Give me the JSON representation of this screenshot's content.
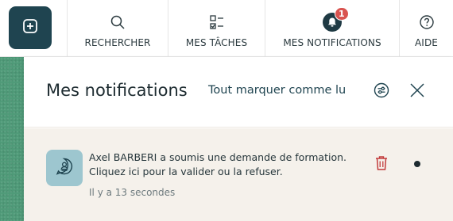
{
  "nav": {
    "search_label": "RECHERCHER",
    "tasks_label": "MES TÂCHES",
    "notifications_label": "MES NOTIFICATIONS",
    "notifications_badge": "1",
    "help_label": "AIDE"
  },
  "panel": {
    "title": "Mes notifications",
    "mark_all_label": "Tout marquer comme lu"
  },
  "notifications": [
    {
      "text_line1": "Axel BARBERI a soumis une demande de formation.",
      "text_line2": "Cliquez ici pour la valider ou la refuser.",
      "time": "Il y a 13 secondes",
      "unread": true
    }
  ],
  "colors": {
    "accent": "#1f4450",
    "sidebar_green": "#4f9a78",
    "badge_red": "#d9534f",
    "notification_bg": "#f5f1eb",
    "avatar_bg": "#9dc6cf",
    "trash_red": "#c23b3b"
  }
}
